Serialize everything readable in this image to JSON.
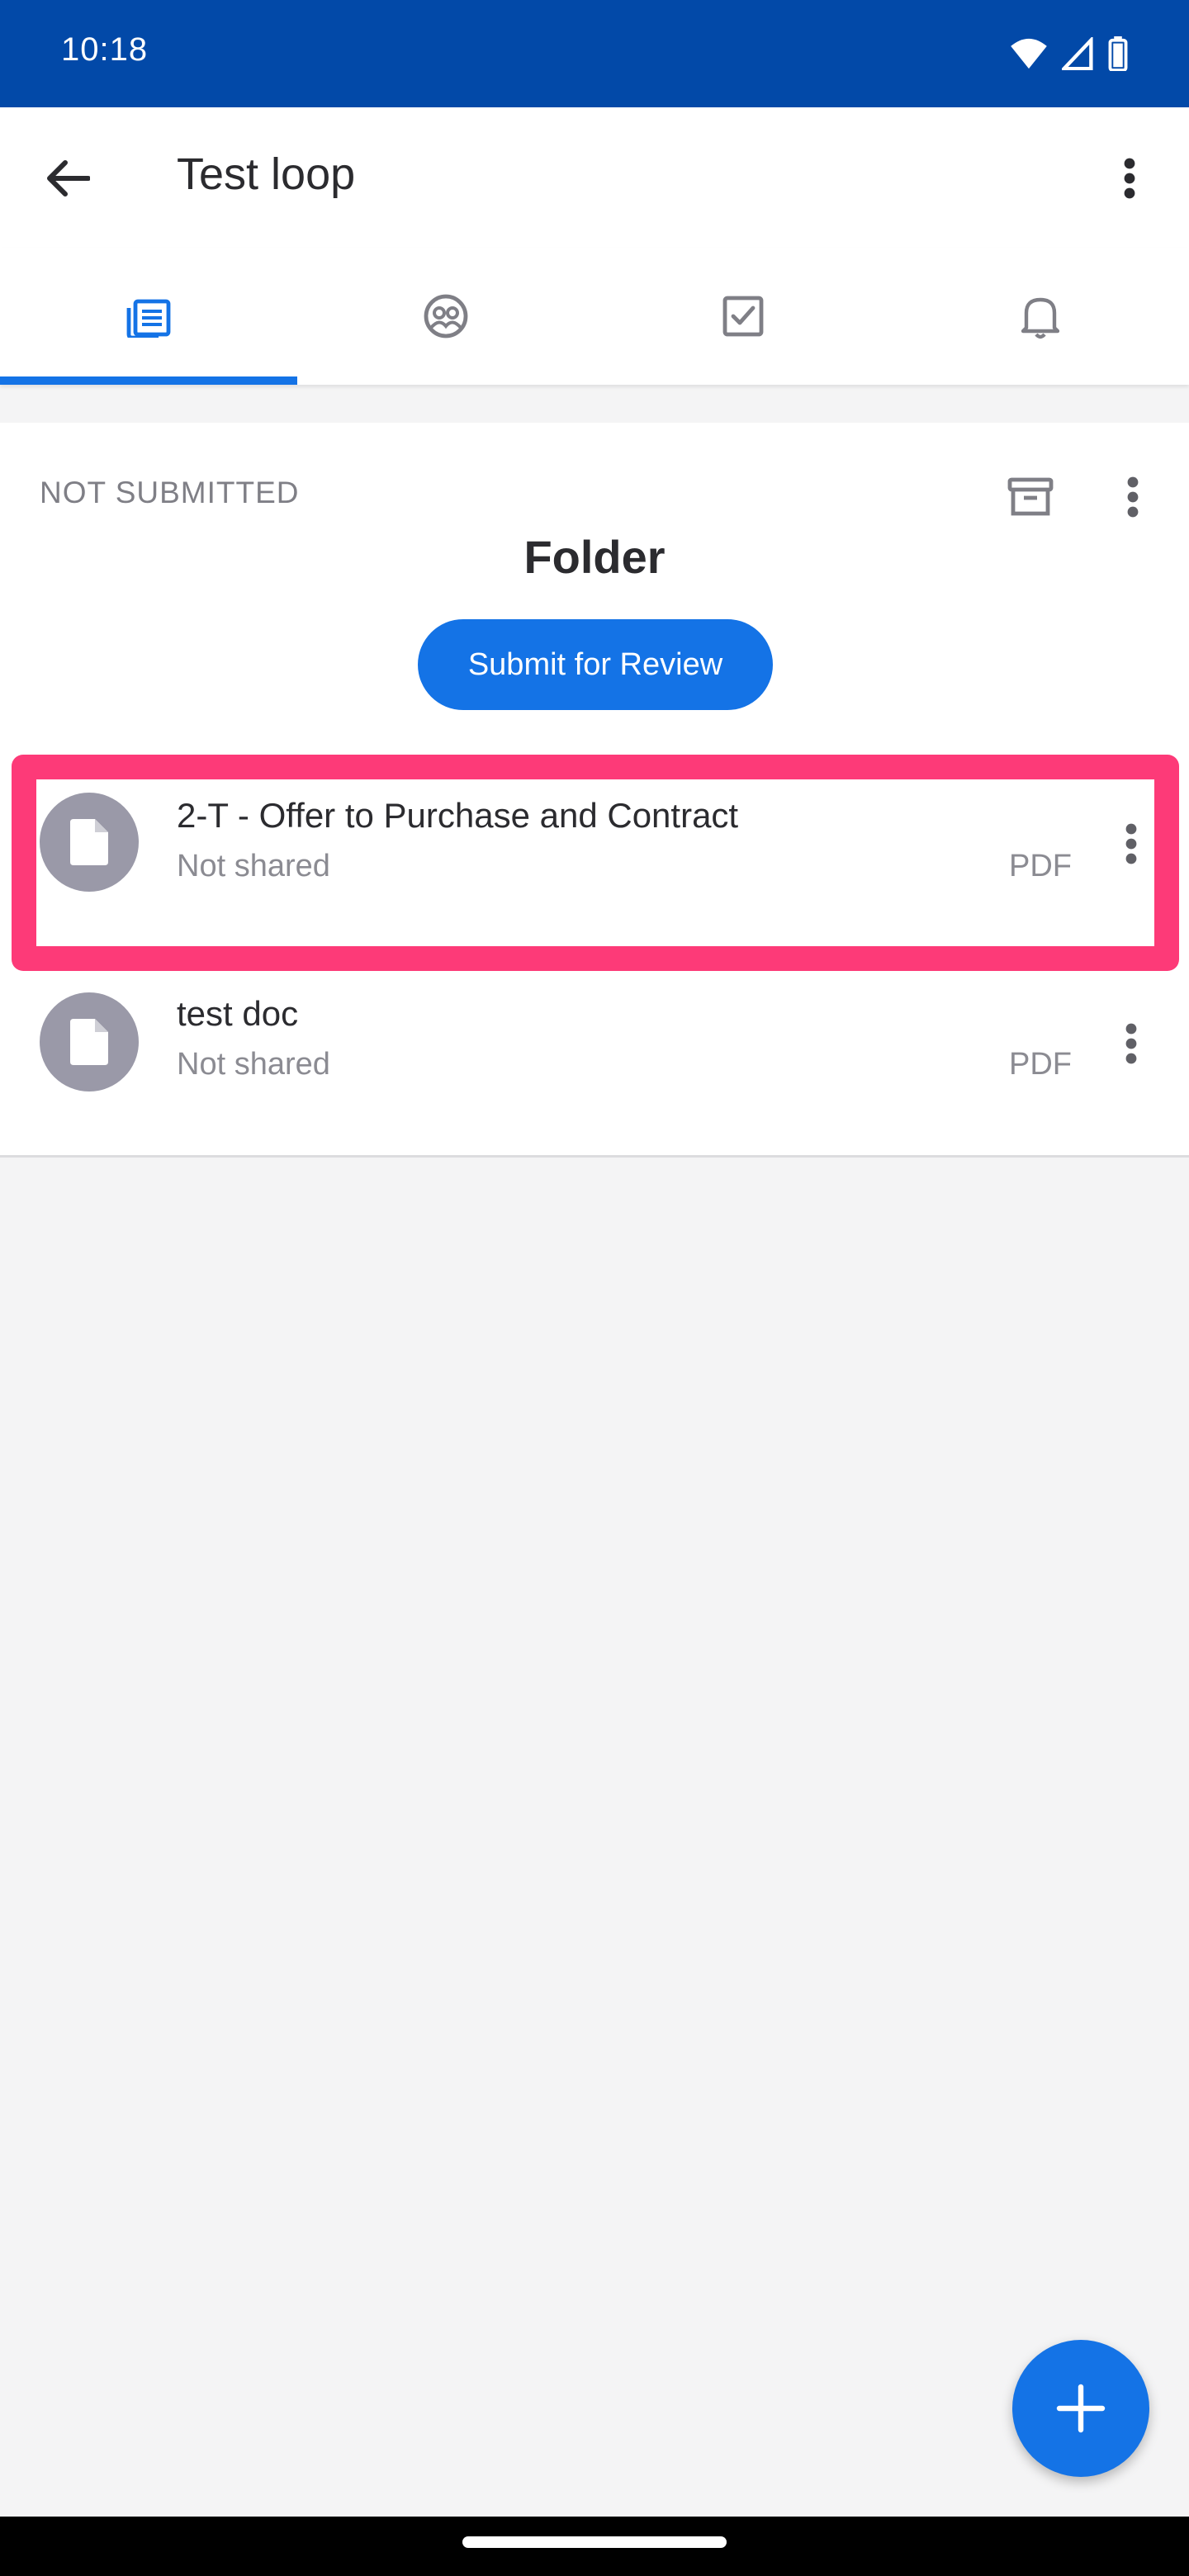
{
  "status_bar": {
    "time": "10:18"
  },
  "app_bar": {
    "title": "Test loop"
  },
  "tabs": [
    {
      "icon": "documents-icon",
      "active": true
    },
    {
      "icon": "people-icon",
      "active": false
    },
    {
      "icon": "tasks-icon",
      "active": false
    },
    {
      "icon": "notifications-icon",
      "active": false
    }
  ],
  "folder": {
    "status": "NOT SUBMITTED",
    "title": "Folder",
    "submit_label": "Submit for Review"
  },
  "documents": [
    {
      "name": "2-T - Offer to Purchase and Contract",
      "share_status": "Not shared",
      "type": "PDF"
    },
    {
      "name": "test doc",
      "share_status": "Not shared",
      "type": "PDF"
    }
  ],
  "colors": {
    "status_bar": "#0249a8",
    "accent": "#1473e6",
    "highlight": "#fd3a78",
    "avatar": "#9a99a8"
  }
}
